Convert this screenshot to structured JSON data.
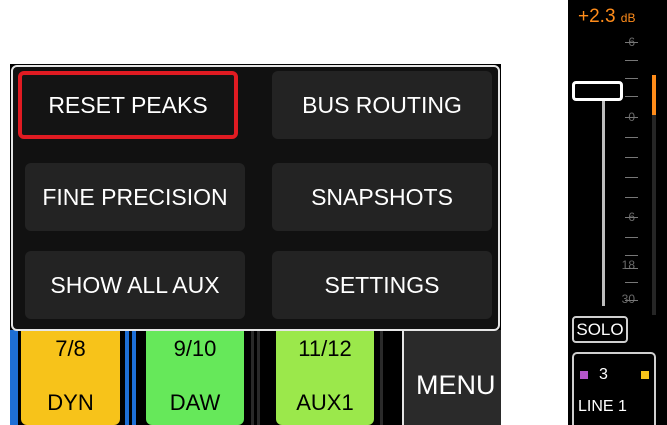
{
  "menu_popup": {
    "items": [
      {
        "label": "RESET PEAKS"
      },
      {
        "label": "BUS ROUTING"
      },
      {
        "label": "FINE PRECISION"
      },
      {
        "label": "SNAPSHOTS"
      },
      {
        "label": "SHOW ALL AUX"
      },
      {
        "label": "SETTINGS"
      }
    ]
  },
  "channel_buttons": [
    {
      "number": "7/8",
      "name": "DYN",
      "color": "#f7c31a"
    },
    {
      "number": "9/10",
      "name": "DAW",
      "color": "#66e85a"
    },
    {
      "number": "11/12",
      "name": "AUX1",
      "color": "#9be84b"
    }
  ],
  "menu_tab": {
    "label": "MENU"
  },
  "channel_strip": {
    "gain_value": "+2.3",
    "gain_unit": "dB",
    "scale": [
      "6",
      "0",
      "6",
      "18",
      "30"
    ],
    "solo_label": "SOLO",
    "channel_number": "3",
    "channel_name": "LINE 1",
    "accent_color": "#ff8c1a",
    "left_marker_color": "#b455c8",
    "right_marker_color": "#f7c31a"
  }
}
